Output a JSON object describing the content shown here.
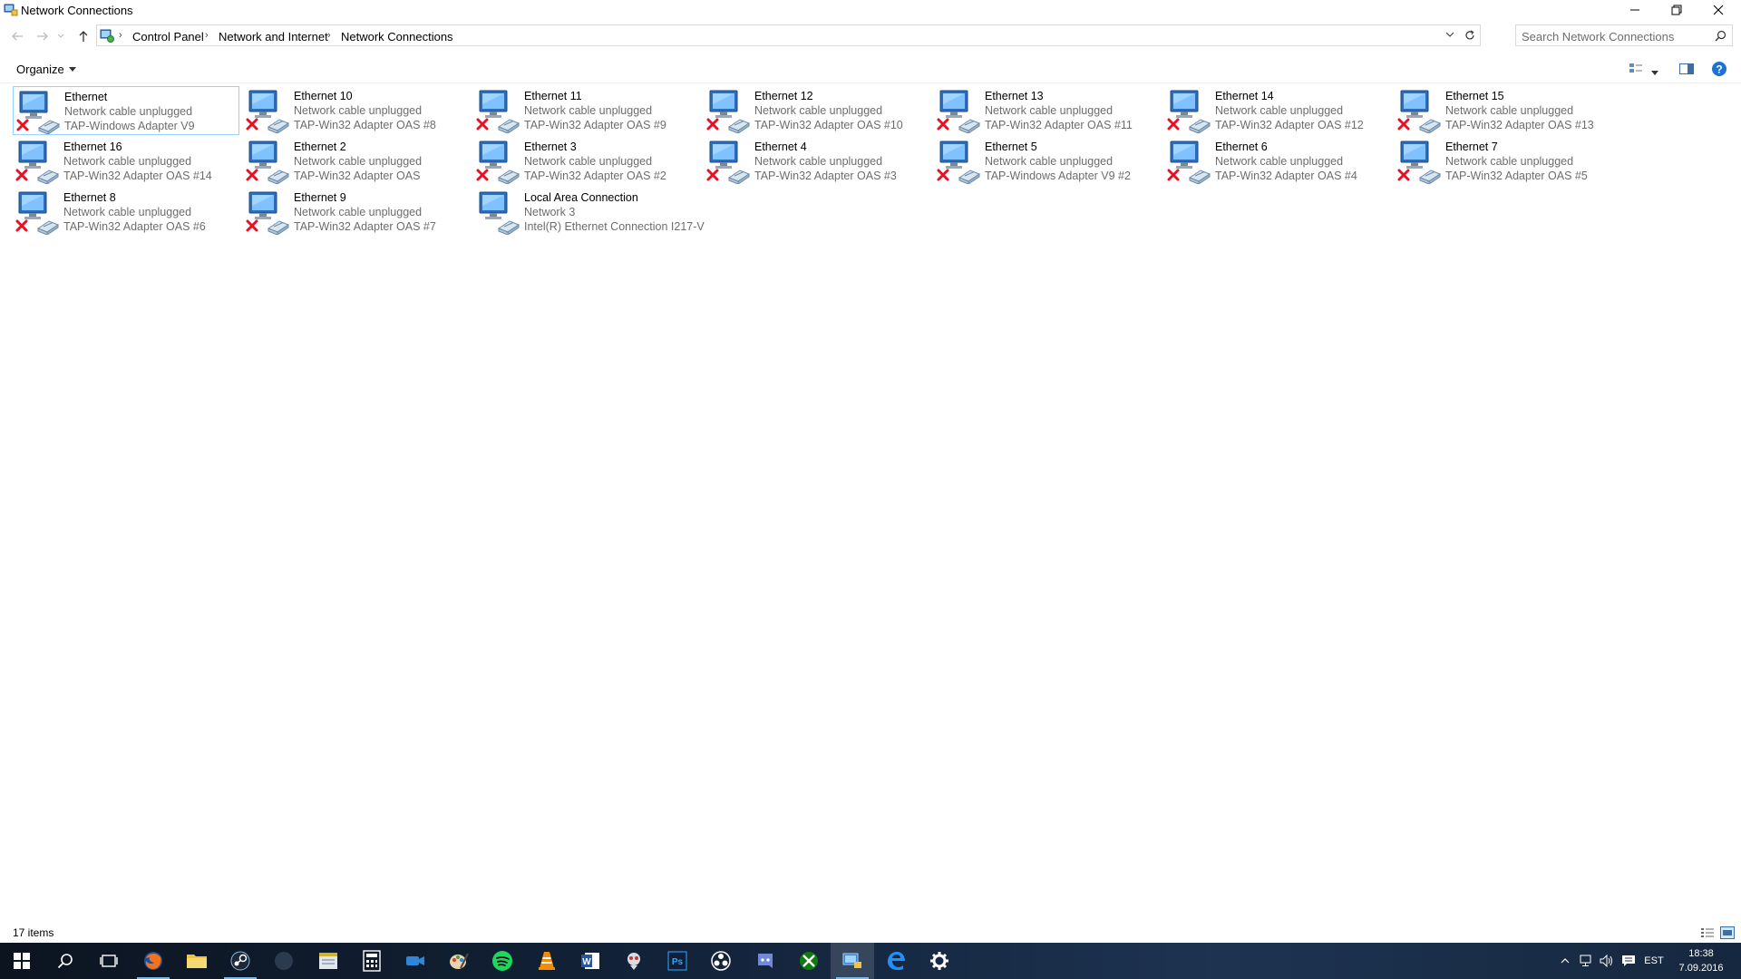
{
  "window": {
    "title": "Network Connections"
  },
  "address": {
    "crumbs": [
      "Control Panel",
      "Network and Internet",
      "Network Connections"
    ]
  },
  "search": {
    "placeholder": "Search Network Connections"
  },
  "toolbar": {
    "organize_label": "Organize"
  },
  "connections": [
    {
      "name": "Ethernet",
      "status": "Network cable unplugged",
      "device": "TAP-Windows Adapter V9",
      "disconnected": true,
      "selected": true
    },
    {
      "name": "Ethernet 10",
      "status": "Network cable unplugged",
      "device": "TAP-Win32 Adapter OAS #8",
      "disconnected": true
    },
    {
      "name": "Ethernet 11",
      "status": "Network cable unplugged",
      "device": "TAP-Win32 Adapter OAS #9",
      "disconnected": true
    },
    {
      "name": "Ethernet 12",
      "status": "Network cable unplugged",
      "device": "TAP-Win32 Adapter OAS #10",
      "disconnected": true
    },
    {
      "name": "Ethernet 13",
      "status": "Network cable unplugged",
      "device": "TAP-Win32 Adapter OAS #11",
      "disconnected": true
    },
    {
      "name": "Ethernet 14",
      "status": "Network cable unplugged",
      "device": "TAP-Win32 Adapter OAS #12",
      "disconnected": true
    },
    {
      "name": "Ethernet 15",
      "status": "Network cable unplugged",
      "device": "TAP-Win32 Adapter OAS #13",
      "disconnected": true
    },
    {
      "name": "Ethernet 16",
      "status": "Network cable unplugged",
      "device": "TAP-Win32 Adapter OAS #14",
      "disconnected": true
    },
    {
      "name": "Ethernet 2",
      "status": "Network cable unplugged",
      "device": "TAP-Win32 Adapter OAS",
      "disconnected": true
    },
    {
      "name": "Ethernet 3",
      "status": "Network cable unplugged",
      "device": "TAP-Win32 Adapter OAS #2",
      "disconnected": true
    },
    {
      "name": "Ethernet 4",
      "status": "Network cable unplugged",
      "device": "TAP-Win32 Adapter OAS #3",
      "disconnected": true
    },
    {
      "name": "Ethernet 5",
      "status": "Network cable unplugged",
      "device": "TAP-Windows Adapter V9 #2",
      "disconnected": true
    },
    {
      "name": "Ethernet 6",
      "status": "Network cable unplugged",
      "device": "TAP-Win32 Adapter OAS #4",
      "disconnected": true
    },
    {
      "name": "Ethernet 7",
      "status": "Network cable unplugged",
      "device": "TAP-Win32 Adapter OAS #5",
      "disconnected": true
    },
    {
      "name": "Ethernet 8",
      "status": "Network cable unplugged",
      "device": "TAP-Win32 Adapter OAS #6",
      "disconnected": true
    },
    {
      "name": "Ethernet 9",
      "status": "Network cable unplugged",
      "device": "TAP-Win32 Adapter OAS #7",
      "disconnected": true
    },
    {
      "name": "Local Area Connection",
      "status": "Network  3",
      "device": "Intel(R) Ethernet Connection I217-V",
      "disconnected": false
    }
  ],
  "status_bar": {
    "item_count": "17 items"
  },
  "taskbar": {
    "apps": [
      "start-icon",
      "search-icon",
      "task-view-icon",
      "firefox-icon",
      "file-explorer-icon",
      "steam-icon",
      "app-icon",
      "notepad-icon",
      "calculator-icon",
      "video-icon",
      "paint-icon",
      "spotify-icon",
      "vlc-icon",
      "word-icon",
      "app-icon",
      "photoshop-icon",
      "obs-icon",
      "discord-icon",
      "xbox-icon",
      "network-connections-icon",
      "edge-icon",
      "settings-icon"
    ],
    "language": "EST",
    "time": "18:38",
    "date": "7.09.2016"
  },
  "colors": {
    "accent": "#0078d7",
    "selection_border": "#99d1ff",
    "secondary_text": "#6d6d6d",
    "error_red": "#e81123"
  }
}
